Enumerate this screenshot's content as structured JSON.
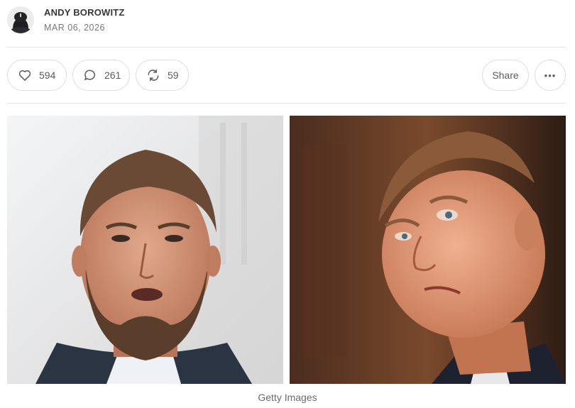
{
  "post": {
    "author": "ANDY BOROWITZ",
    "date": "MAR 06, 2026"
  },
  "actions": {
    "likes": "594",
    "comments": "261",
    "restacks": "59",
    "share_label": "Share",
    "more_label": "•••"
  },
  "figure": {
    "caption": "Getty Images",
    "left_photo": "man-with-beard",
    "right_photo": "man-frowning"
  },
  "colors": {
    "text": "#363737",
    "muted": "#777777",
    "border": "#dedede"
  }
}
